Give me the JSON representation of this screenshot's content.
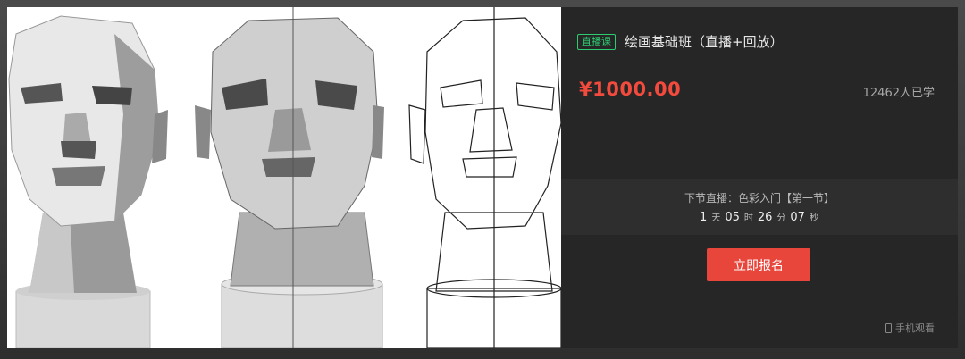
{
  "course": {
    "tag": "直播课",
    "title": "绘画基础班（直播+回放）",
    "price": "¥1000.00",
    "enrolled": "12462人已学"
  },
  "next_lesson": {
    "text": "下节直播：色彩入门【第一节】",
    "countdown": {
      "days": "1",
      "days_unit": "天",
      "hours": "05",
      "hours_unit": "时",
      "minutes": "26",
      "minutes_unit": "分",
      "seconds": "07",
      "seconds_unit": "秒"
    }
  },
  "actions": {
    "enroll_label": "立即报名",
    "mobile_label": "手机观看"
  },
  "colors": {
    "accent": "#e8463b",
    "price": "#f24a3c",
    "live_tag": "#2ecc71",
    "panel_bg": "#262626"
  },
  "icons": {
    "mobile": "phone-icon"
  }
}
